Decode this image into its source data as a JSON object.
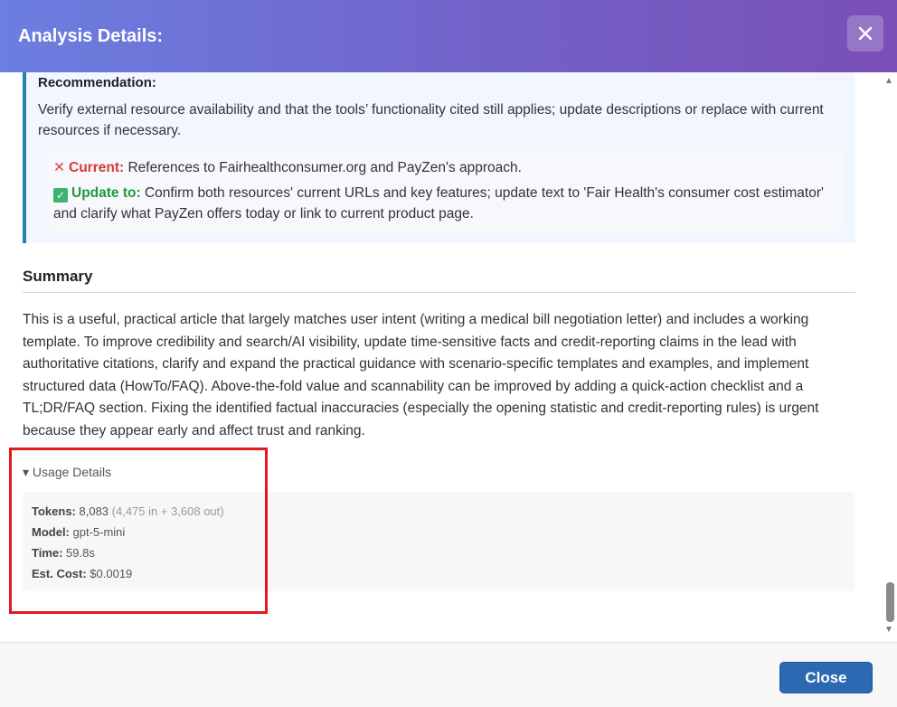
{
  "dialog": {
    "title": "Analysis Details:",
    "close_icon": "close-icon"
  },
  "recommendation": {
    "heading": "Recommendation:",
    "text": "Verify external resource availability and that the tools’ functionality cited still applies; update descriptions or replace with current resources if necessary.",
    "current_icon": "cross-mark-icon",
    "current_label": "Current:",
    "current_text": " References to Fairhealthconsumer.org and PayZen's approach.",
    "update_icon": "check-mark-icon",
    "update_label": "Update to:",
    "update_text": " Confirm both resources' current URLs and key features; update text to 'Fair Health's consumer cost estimator' and clarify what PayZen offers today or link to current product page."
  },
  "summary": {
    "heading": "Summary",
    "text": "This is a useful, practical article that largely matches user intent (writing a medical bill negotiation letter) and includes a working template. To improve credibility and search/AI visibility, update time-sensitive facts and credit-reporting claims in the lead with authoritative citations, clarify and expand the practical guidance with scenario-specific templates and examples, and implement structured data (HowTo/FAQ). Above-the-fold value and scannability can be improved by adding a quick-action checklist and a TL;DR/FAQ section. Fixing the identified factual inaccuracies (especially the opening statistic and credit-reporting rules) is urgent because they appear early and affect trust and ranking."
  },
  "usage": {
    "toggle_label": "▾ Usage Details",
    "tokens_label": "Tokens:",
    "tokens_value": " 8,083 ",
    "tokens_breakdown": "(4,475 in + 3,608 out)",
    "model_label": "Model:",
    "model_value": " gpt-5-mini",
    "time_label": "Time:",
    "time_value": " 59.8s",
    "cost_label": "Est. Cost:",
    "cost_value": " $0.0019"
  },
  "footer": {
    "close_label": "Close"
  },
  "colors": {
    "header_start": "#6b7fe0",
    "header_end": "#7a4fb6",
    "accent_border": "#1d86a6",
    "current_red": "#d63a3a",
    "update_green": "#1f9a3f",
    "highlight_red": "#e0191b",
    "close_button": "#2b6ab2"
  }
}
